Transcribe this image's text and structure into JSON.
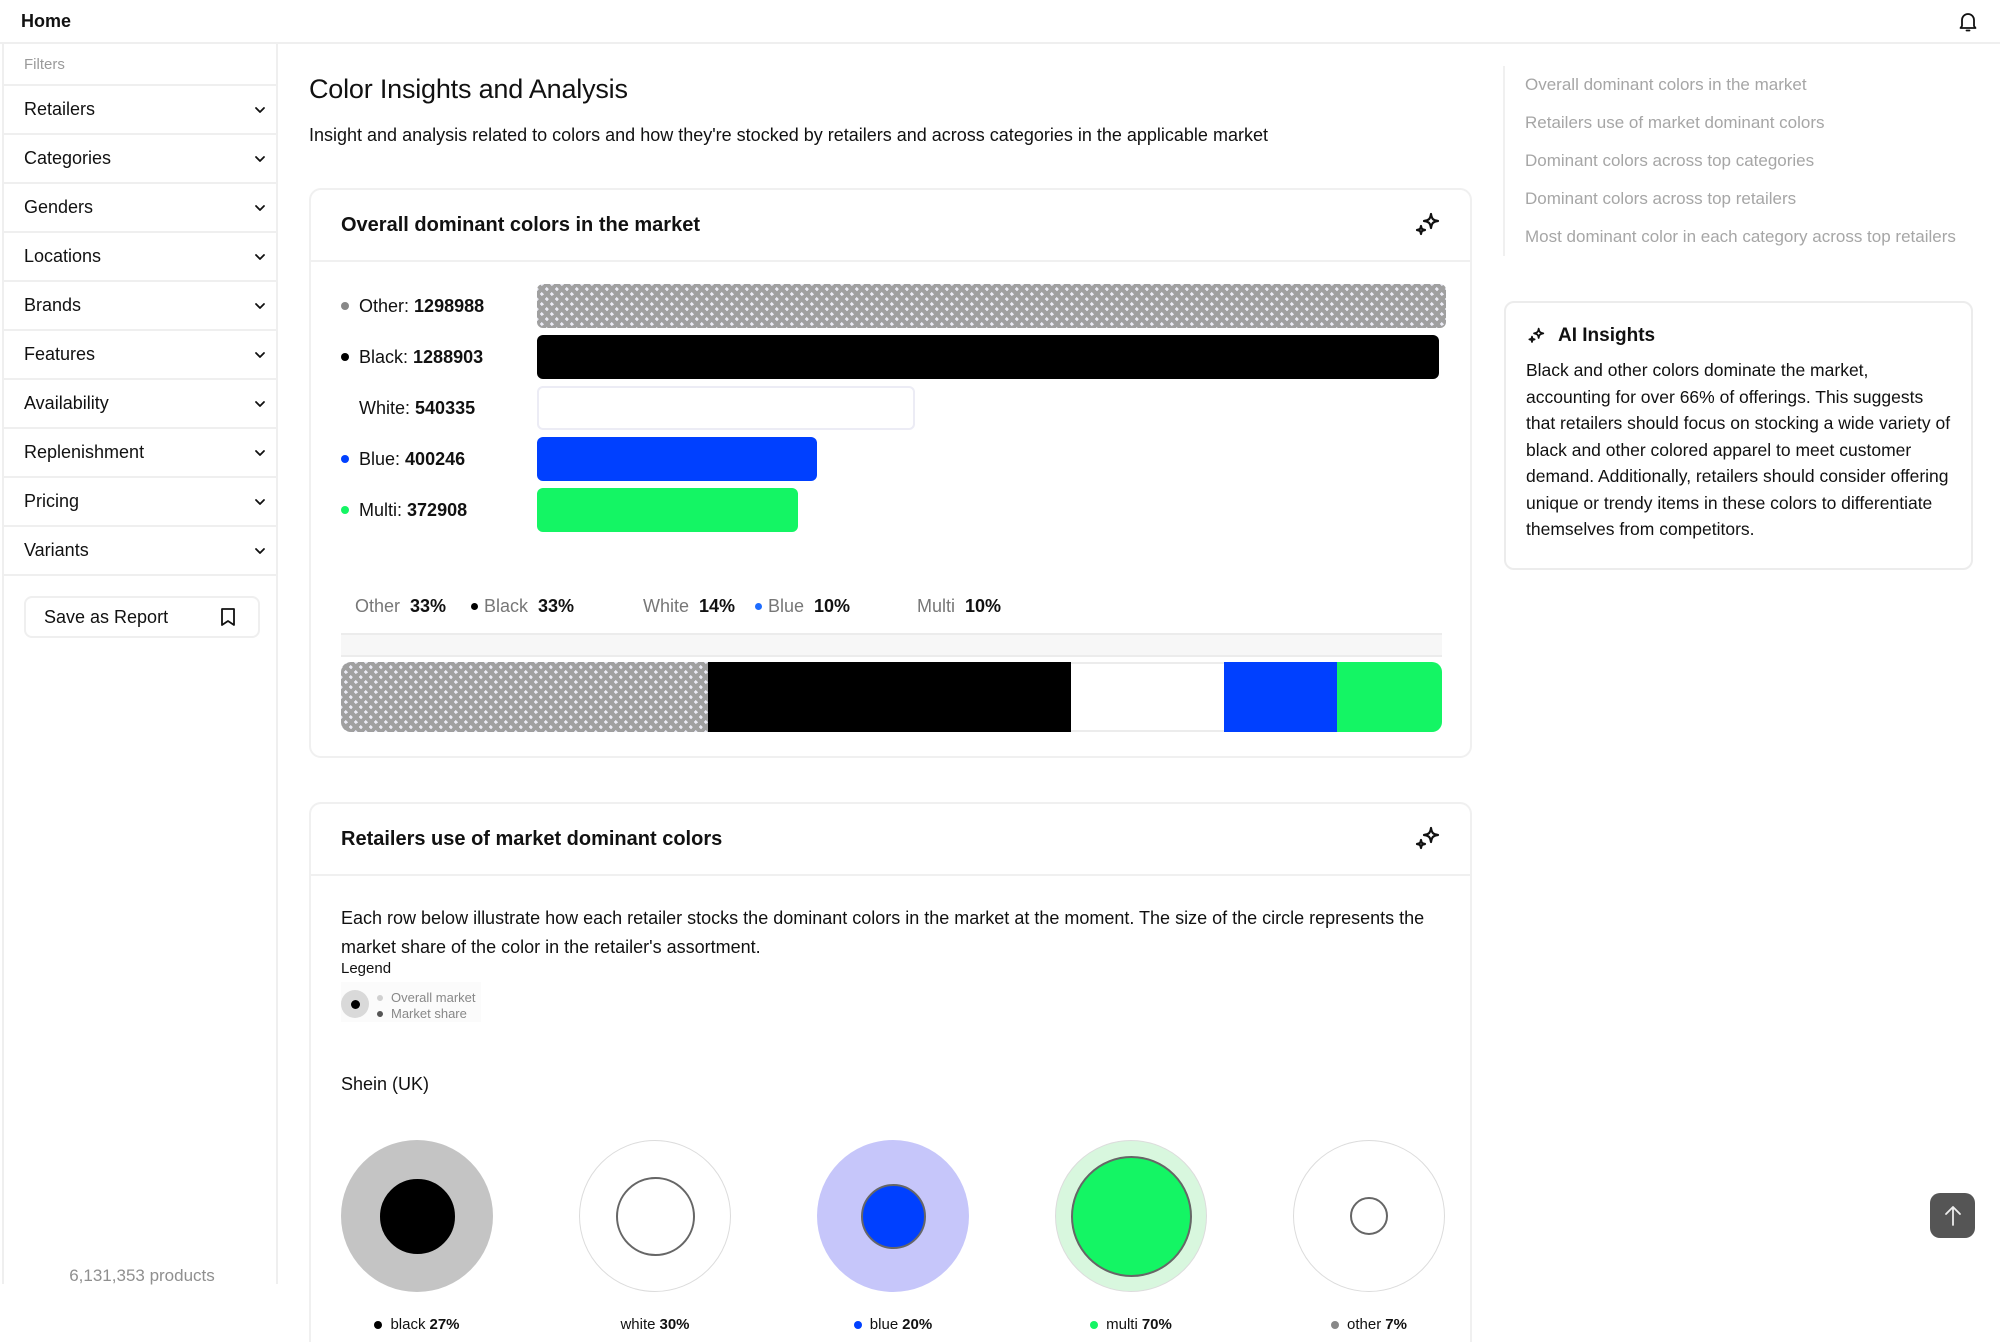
{
  "topbar": {
    "home_label": "Home",
    "notification_icon": "bell-icon"
  },
  "sidebar": {
    "filters_label": "Filters",
    "items": [
      {
        "label": "Retailers"
      },
      {
        "label": "Categories"
      },
      {
        "label": "Genders"
      },
      {
        "label": "Locations"
      },
      {
        "label": "Brands"
      },
      {
        "label": "Features"
      },
      {
        "label": "Availability"
      },
      {
        "label": "Replenishment"
      },
      {
        "label": "Pricing"
      },
      {
        "label": "Variants"
      }
    ],
    "save_report_label": "Save as Report",
    "products_count": "6,131,353 products"
  },
  "page": {
    "title": "Color Insights and Analysis",
    "description": "Insight and analysis related to colors and how they're stocked by retailers and across categories in the applicable market"
  },
  "overall_card": {
    "title": "Overall dominant colors in the market",
    "bars": [
      {
        "name": "Other",
        "value": 1298988,
        "value_text": "1298988",
        "color": "#a0a0a0",
        "dot": "#888888",
        "pattern": true
      },
      {
        "name": "Black",
        "value": 1288903,
        "value_text": "1288903",
        "color": "#000000",
        "dot": "#000000"
      },
      {
        "name": "White",
        "value": 540335,
        "value_text": "540335",
        "color": "#ffffff",
        "dot": null
      },
      {
        "name": "Blue",
        "value": 400246,
        "value_text": "400246",
        "color": "#0040ff",
        "dot": "#0040ff"
      },
      {
        "name": "Multi",
        "value": 372908,
        "value_text": "372908",
        "color": "#14f564",
        "dot": "#14f564"
      }
    ],
    "shares": [
      {
        "name": "Other",
        "pct_text": "33%",
        "pct": 33,
        "dot": null
      },
      {
        "name": "Black",
        "pct_text": "33%",
        "pct": 33,
        "dot": "#000000"
      },
      {
        "name": "White",
        "pct_text": "14%",
        "pct": 14,
        "dot": null
      },
      {
        "name": "Blue",
        "pct_text": "10%",
        "pct": 10,
        "dot": "#1e6cff"
      },
      {
        "name": "Multi",
        "pct_text": "10%",
        "pct": 10,
        "dot": null
      }
    ]
  },
  "retailers_card": {
    "title": "Retailers use of market dominant colors",
    "description": "Each row below illustrate how each retailer stocks the dominant colors in the market at the moment. The size of the circle represents the market share of the color in the retailer's assortment.",
    "legend": {
      "title": "Legend",
      "overall_label": "Overall market",
      "share_label": "Market share"
    },
    "retailers": [
      {
        "name": "Shein (UK)",
        "colors": [
          {
            "name": "black",
            "pct_text": "27%",
            "share": 0.27,
            "fill": "#000000",
            "outer": "#c4c4c4",
            "dot": "#000000"
          },
          {
            "name": "white",
            "pct_text": "30%",
            "share": 0.3,
            "fill": "#ffffff",
            "outer": "#ffffff",
            "dot": null
          },
          {
            "name": "blue",
            "pct_text": "20%",
            "share": 0.2,
            "fill": "#0040ff",
            "outer": "#c6c6fa",
            "dot": "#0040ff"
          },
          {
            "name": "multi",
            "pct_text": "70%",
            "share": 0.7,
            "fill": "#14f564",
            "outer": "#d8f7de",
            "dot": "#14f564"
          },
          {
            "name": "other",
            "pct_text": "7%",
            "share": 0.07,
            "fill": "#ffffff",
            "outer": "#ffffff",
            "dot": "#888888"
          }
        ]
      }
    ]
  },
  "toc": {
    "items": [
      "Overall dominant colors in the market",
      "Retailers use of market dominant colors",
      "Dominant colors across top categories",
      "Dominant colors across top retailers",
      "Most dominant color in each category across top retailers"
    ]
  },
  "ai_insights": {
    "title": "AI Insights",
    "body": "Black and other colors dominate the market, accounting for over 66% of offerings. This suggests that retailers should focus on stocking a wide variety of black and other colored apparel to meet customer demand. Additionally, retailers should consider offering unique or trendy items in these colors to differentiate themselves from competitors."
  }
}
